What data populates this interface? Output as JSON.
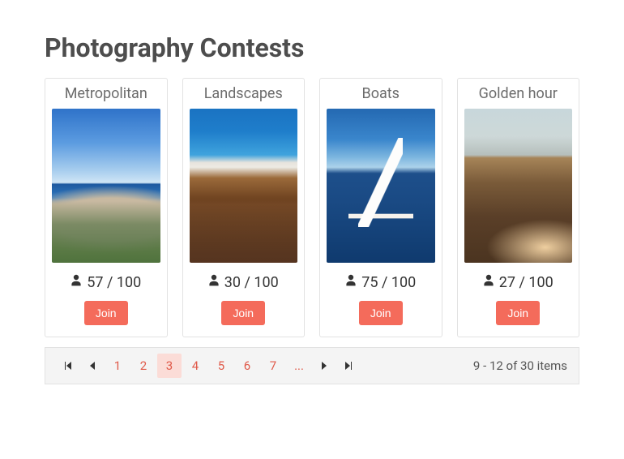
{
  "page": {
    "title": "Photography Contests"
  },
  "cards": [
    {
      "title": "Metropolitan",
      "participants": "57 / 100",
      "join": "Join"
    },
    {
      "title": "Landscapes",
      "participants": "30 / 100",
      "join": "Join"
    },
    {
      "title": "Boats",
      "participants": "75 / 100",
      "join": "Join"
    },
    {
      "title": "Golden hour",
      "participants": "27 / 100",
      "join": "Join"
    }
  ],
  "pager": {
    "pages": [
      "1",
      "2",
      "3",
      "4",
      "5",
      "6",
      "7",
      "..."
    ],
    "active_index": 2,
    "info": "9 - 12 of 30 items"
  }
}
